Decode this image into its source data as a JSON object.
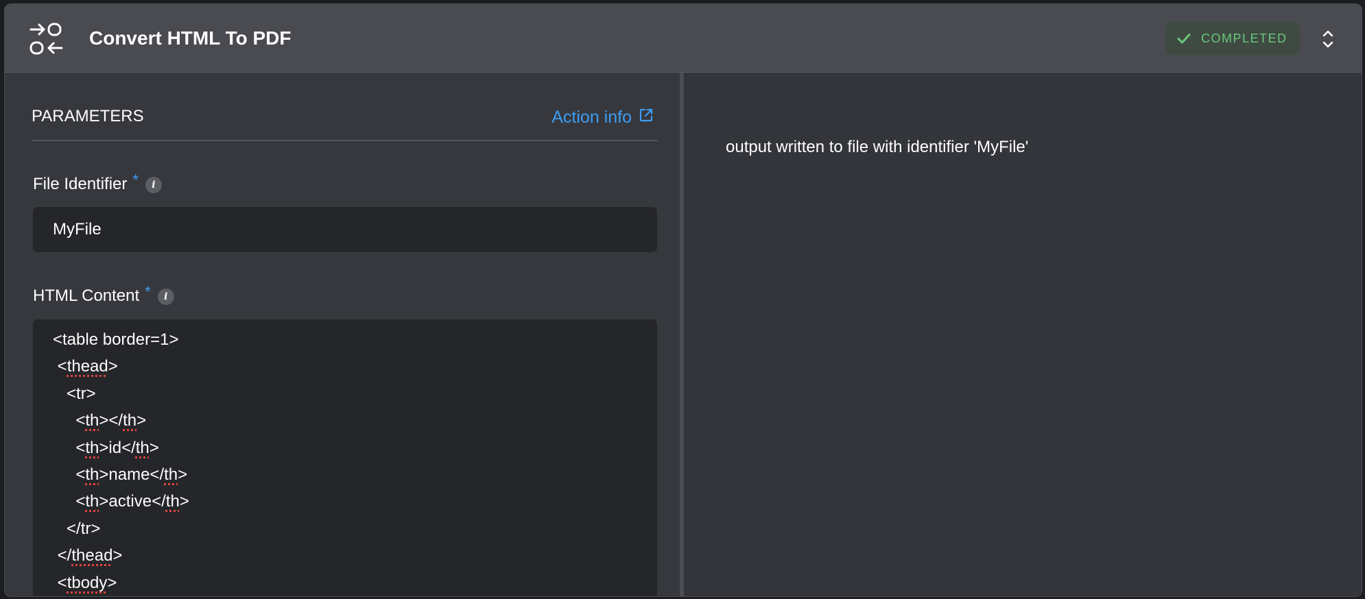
{
  "header": {
    "title": "Convert HTML To PDF",
    "icon": "convert-arrows-icon",
    "status": "COMPLETED",
    "status_color": "#69c97a"
  },
  "parameters": {
    "heading": "PARAMETERS",
    "action_info_label": "Action info",
    "link_color": "#3d9df3",
    "file_identifier": {
      "label": "File Identifier",
      "required": "*",
      "info": "i",
      "value": "MyFile"
    },
    "html_content": {
      "label": "HTML Content",
      "required": "*",
      "info": "i",
      "lines": [
        [
          {
            "t": "<table border=1>"
          }
        ],
        [
          {
            "t": " <"
          },
          {
            "t": "thead",
            "sp": true
          },
          {
            "t": ">"
          }
        ],
        [
          {
            "t": "   <tr>"
          }
        ],
        [
          {
            "t": "     <"
          },
          {
            "t": "th",
            "sp": true
          },
          {
            "t": "></"
          },
          {
            "t": "th",
            "sp": true
          },
          {
            "t": ">"
          }
        ],
        [
          {
            "t": "     <"
          },
          {
            "t": "th",
            "sp": true
          },
          {
            "t": ">id</"
          },
          {
            "t": "th",
            "sp": true
          },
          {
            "t": ">"
          }
        ],
        [
          {
            "t": "     <"
          },
          {
            "t": "th",
            "sp": true
          },
          {
            "t": ">name</"
          },
          {
            "t": "th",
            "sp": true
          },
          {
            "t": ">"
          }
        ],
        [
          {
            "t": "     <"
          },
          {
            "t": "th",
            "sp": true
          },
          {
            "t": ">active</"
          },
          {
            "t": "th",
            "sp": true
          },
          {
            "t": ">"
          }
        ],
        [
          {
            "t": "   </tr>"
          }
        ],
        [
          {
            "t": " </"
          },
          {
            "t": "thead",
            "sp": true
          },
          {
            "t": ">"
          }
        ],
        [
          {
            "t": " <"
          },
          {
            "t": "tbody",
            "sp": true
          },
          {
            "t": ">"
          }
        ]
      ]
    }
  },
  "output": {
    "text": "output written to file with identifier 'MyFile'"
  }
}
